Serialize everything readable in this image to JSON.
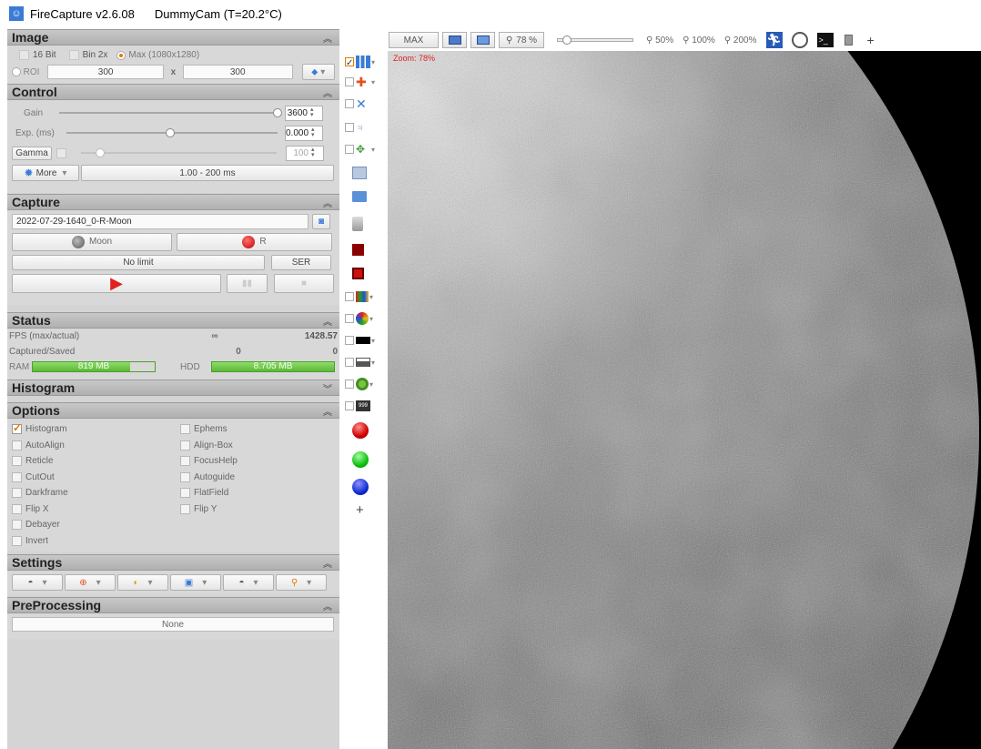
{
  "window": {
    "app_title": "FireCapture v2.6.08",
    "camera_title": "DummyCam (T=20.2°C)"
  },
  "image": {
    "title": "Image",
    "bit16": "16 Bit",
    "bin2x": "Bin 2x",
    "max_label": "Max (1080x1280)",
    "roi_label": "ROI",
    "roi_w": "300",
    "roi_x": "x",
    "roi_h": "300"
  },
  "control": {
    "title": "Control",
    "gain_label": "Gain",
    "gain_value": "3600",
    "gain_level": 1.0,
    "exp_label": "Exp. (ms)",
    "exp_value": "0.000",
    "exp_level": 0.49,
    "gamma_label": "Gamma",
    "gamma_value": "100",
    "more_label": "More",
    "range_label": "1.00 - 200 ms"
  },
  "capture": {
    "title": "Capture",
    "filename": "2022-07-29-1640_0-R-Moon",
    "object_label": "Moon",
    "filter_label": "R",
    "limit_label": "No limit",
    "format_label": "SER"
  },
  "status": {
    "title": "Status",
    "fps_label": "FPS (max/actual)",
    "fps_max": "∞",
    "fps_actual": "1428.57",
    "cap_label": "Captured/Saved",
    "captured": "0",
    "saved": "0",
    "ram_label": "RAM",
    "ram_value": "819 MB",
    "ram_level": 0.8,
    "hdd_label": "HDD",
    "hdd_value": "8.705 MB",
    "hdd_level": 1.0
  },
  "histogram": {
    "title": "Histogram"
  },
  "options": {
    "title": "Options",
    "left": [
      "Histogram",
      "AutoAlign",
      "Reticle",
      "CutOut",
      "Darkframe",
      "Flip X",
      "Debayer",
      "Invert"
    ],
    "right": [
      "Ephems",
      "Align-Box",
      "FocusHelp",
      "Autoguide",
      "FlatField",
      "Flip Y"
    ]
  },
  "settings": {
    "title": "Settings"
  },
  "preprocessing": {
    "title": "PreProcessing",
    "value": "None"
  },
  "toolbar": {
    "max_label": "MAX",
    "zoom_value": "78 %",
    "zoom_level": 0.12,
    "z50": "50%",
    "z100": "100%",
    "z200": "200%",
    "plus": "+"
  },
  "viewport": {
    "zoom_overlay": "Zoom: 78%"
  },
  "toolstrip": {
    "plus": "+"
  },
  "colors": {
    "accent_orange": "#e07a00",
    "red_ball": "#e01010",
    "green_ball": "#20c020",
    "blue_ball": "#1030d0"
  }
}
